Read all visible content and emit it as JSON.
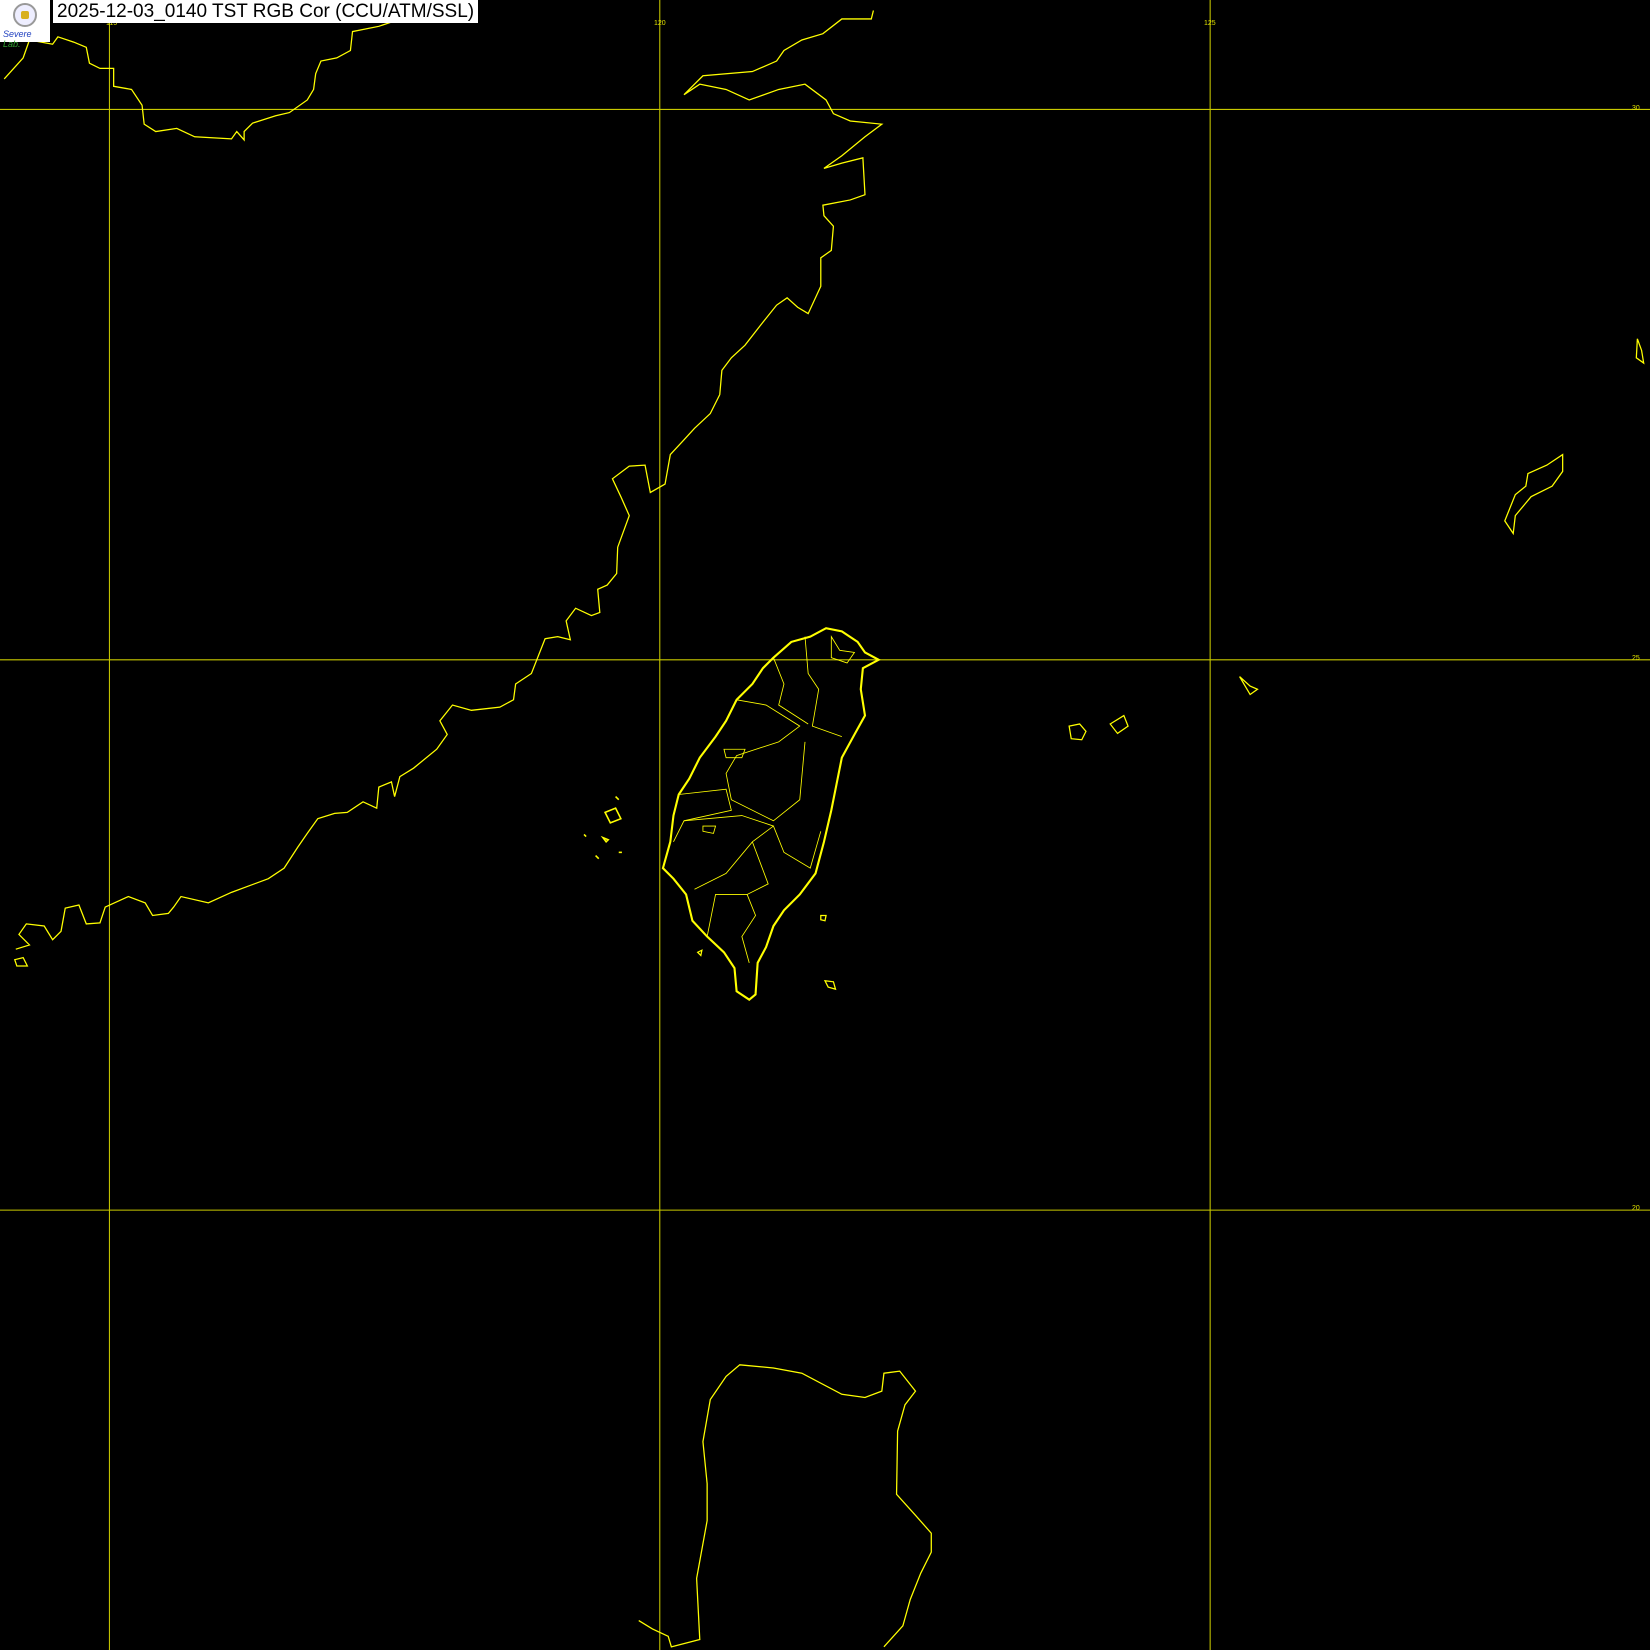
{
  "header": {
    "title": "2025-12-03_0140 TST RGB Cor (CCU/ATM/SSL)",
    "logo_text": "Severe Storm Lab."
  },
  "map": {
    "background": "#000000",
    "line_color": "#ffff00",
    "grid_color": "#c8c800",
    "longitude_labels": [
      "115",
      "120",
      "125"
    ],
    "latitude_labels": [
      "30",
      "25",
      "20"
    ]
  }
}
